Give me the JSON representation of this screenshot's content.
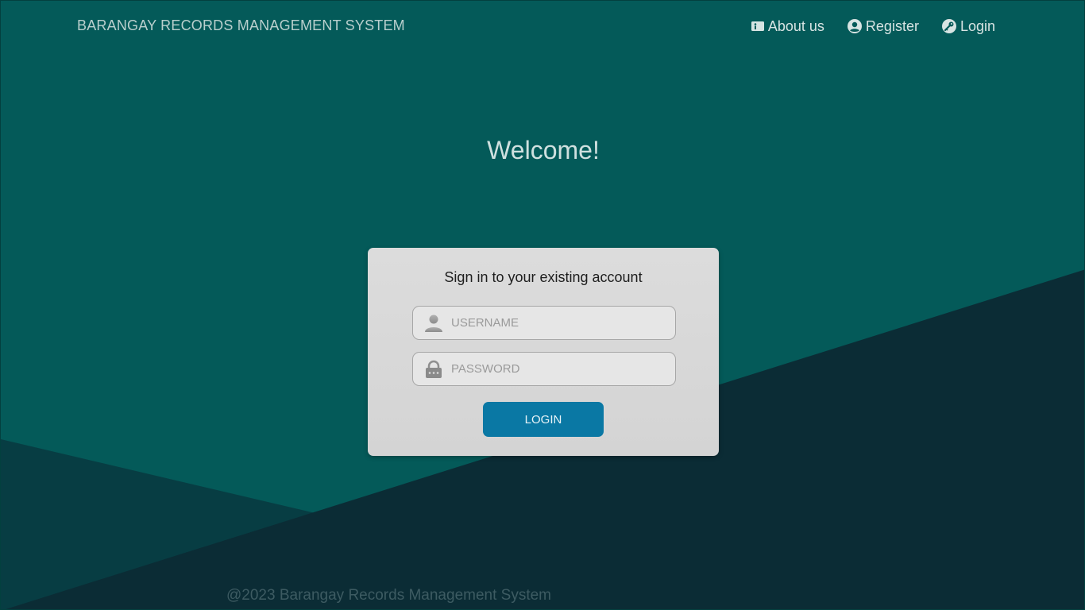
{
  "header": {
    "brand": "BARANGAY RECORDS MANAGEMENT SYSTEM",
    "nav": [
      {
        "label": "About us",
        "icon": "info-card-icon"
      },
      {
        "label": "Register",
        "icon": "user-circle-icon"
      },
      {
        "label": "Login",
        "icon": "key-icon"
      }
    ]
  },
  "main": {
    "heading": "Welcome!"
  },
  "login_card": {
    "title": "Sign in to your existing account",
    "username_placeholder": "USERNAME",
    "username_icon": "user-icon",
    "password_placeholder": "PASSWORD",
    "password_icon": "lock-icon",
    "button_label": "LOGIN"
  },
  "footer": {
    "text": "@2023 Barangay Records Management System"
  },
  "colors": {
    "background": "#045a59",
    "dark_shape": "#0b2c35",
    "card": "#d9d9d9",
    "button": "#0a78a4"
  }
}
